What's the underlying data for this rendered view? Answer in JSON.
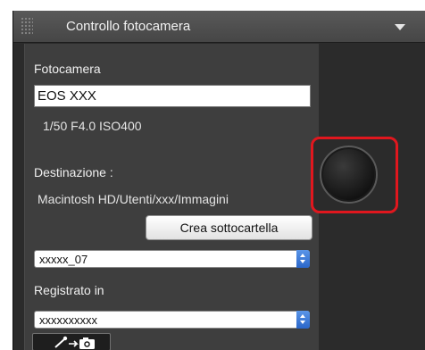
{
  "panel": {
    "title": "Controllo fotocamera",
    "collapse_icon": "triangle-down-icon"
  },
  "camera": {
    "section_label": "Fotocamera",
    "model": "EOS XXX",
    "settings": "1/50  F4.0  ISO400"
  },
  "destination": {
    "label": "Destinazione :",
    "path": "Macintosh HD/Utenti/xxx/Immagini",
    "create_subfolder_label": "Crea sottocartella",
    "subfolder_value": "xxxxx_07"
  },
  "recorded": {
    "label": "Registrato in",
    "value": "xxxxxxxxxx"
  },
  "tool_button_icon": "eyedropper-camera-icon",
  "shutter_icon": "shutter-button-icon",
  "colors": {
    "highlight": "#e0171e",
    "select_accent": "#2a66c9",
    "panel_bg": "#2b2b2b",
    "section_bg": "#3e3e3e"
  }
}
